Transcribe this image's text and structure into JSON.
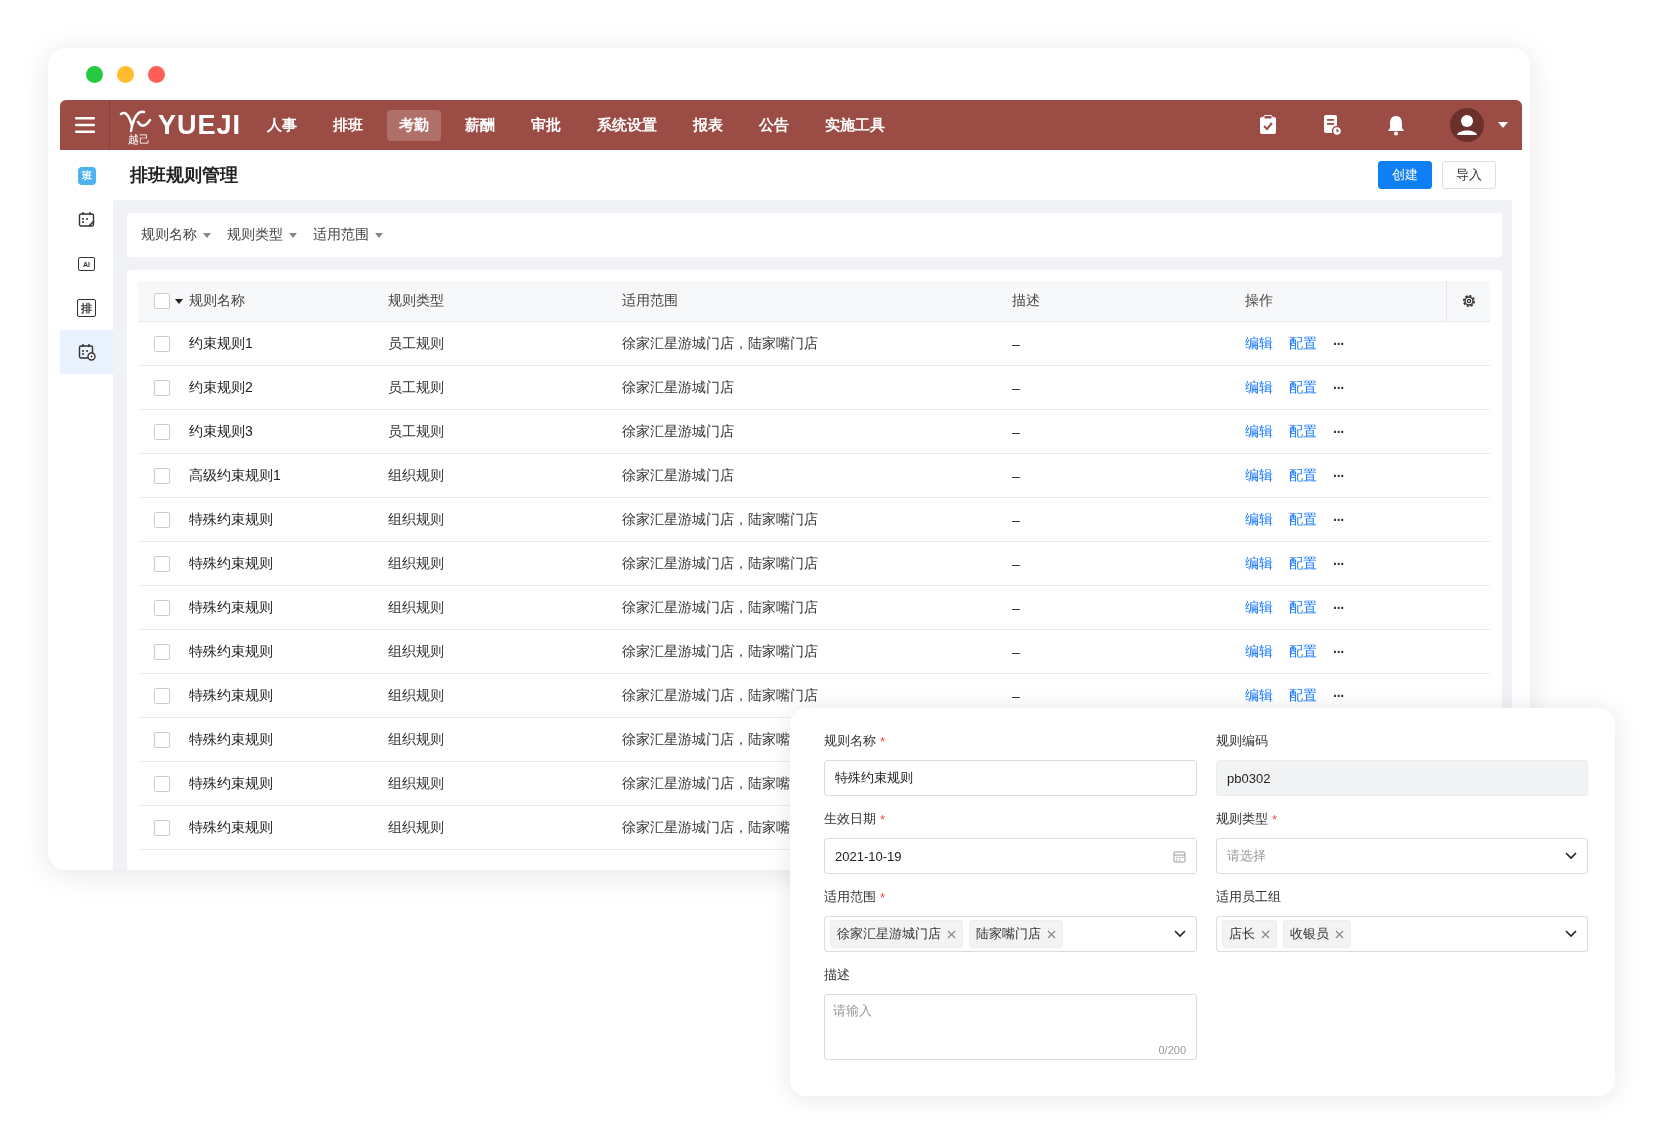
{
  "logo": {
    "mark": "越己",
    "text": "YUEJI"
  },
  "nav": [
    {
      "label": "人事",
      "selected": false
    },
    {
      "label": "排班",
      "selected": false
    },
    {
      "label": "考勤",
      "selected": true
    },
    {
      "label": "薪酬",
      "selected": false
    },
    {
      "label": "审批",
      "selected": false
    },
    {
      "label": "系统设置",
      "selected": false
    },
    {
      "label": "报表",
      "selected": false
    },
    {
      "label": "公告",
      "selected": false
    },
    {
      "label": "实施工具",
      "selected": false
    }
  ],
  "sidebar": [
    {
      "kind": "badge",
      "glyph": "班",
      "selected": false
    },
    {
      "kind": "calendar-edit",
      "selected": false
    },
    {
      "kind": "monitor",
      "glyph": "AI",
      "selected": false
    },
    {
      "kind": "board",
      "glyph": "排",
      "selected": false
    },
    {
      "kind": "calendar-gear",
      "selected": true
    }
  ],
  "page_title": "排班规则管理",
  "actions": [
    {
      "label": "创建",
      "kind": "primary"
    },
    {
      "label": "导入",
      "kind": "default"
    }
  ],
  "filters": [
    "规则名称",
    "规则类型",
    "适用范围"
  ],
  "table": {
    "select_all_checked": false,
    "columns": [
      "规则名称",
      "规则类型",
      "适用范围",
      "描述",
      "操作"
    ],
    "rows": [
      {
        "name": "约束规则1",
        "type": "员工规则",
        "scope": "徐家汇星游城门店，陆家嘴门店",
        "desc": "–",
        "ops": [
          "编辑",
          "配置",
          "···"
        ],
        "checked": false
      },
      {
        "name": "约束规则2",
        "type": "员工规则",
        "scope": "徐家汇星游城门店",
        "desc": "–",
        "ops": [
          "编辑",
          "配置",
          "···"
        ],
        "checked": false
      },
      {
        "name": "约束规则3",
        "type": "员工规则",
        "scope": "徐家汇星游城门店",
        "desc": "–",
        "ops": [
          "编辑",
          "配置",
          "···"
        ],
        "checked": false
      },
      {
        "name": "高级约束规则1",
        "type": "组织规则",
        "scope": "徐家汇星游城门店",
        "desc": "–",
        "ops": [
          "编辑",
          "配置",
          "···"
        ],
        "checked": false
      },
      {
        "name": "特殊约束规则",
        "type": "组织规则",
        "scope": "徐家汇星游城门店，陆家嘴门店",
        "desc": "–",
        "ops": [
          "编辑",
          "配置",
          "···"
        ],
        "checked": false
      },
      {
        "name": "特殊约束规则",
        "type": "组织规则",
        "scope": "徐家汇星游城门店，陆家嘴门店",
        "desc": "–",
        "ops": [
          "编辑",
          "配置",
          "···"
        ],
        "checked": false
      },
      {
        "name": "特殊约束规则",
        "type": "组织规则",
        "scope": "徐家汇星游城门店，陆家嘴门店",
        "desc": "–",
        "ops": [
          "编辑",
          "配置",
          "···"
        ],
        "checked": false
      },
      {
        "name": "特殊约束规则",
        "type": "组织规则",
        "scope": "徐家汇星游城门店，陆家嘴门店",
        "desc": "–",
        "ops": [
          "编辑",
          "配置",
          "···"
        ],
        "checked": false
      },
      {
        "name": "特殊约束规则",
        "type": "组织规则",
        "scope": "徐家汇星游城门店，陆家嘴门店",
        "desc": "–",
        "ops": [
          "编辑",
          "配置",
          "···"
        ],
        "checked": false
      },
      {
        "name": "特殊约束规则",
        "type": "组织规则",
        "scope": "徐家汇星游城门店，陆家嘴",
        "checked": false
      },
      {
        "name": "特殊约束规则",
        "type": "组织规则",
        "scope": "徐家汇星游城门店，陆家嘴",
        "checked": false
      },
      {
        "name": "特殊约束规则",
        "type": "组织规则",
        "scope": "徐家汇星游城门店，陆家嘴",
        "checked": false
      }
    ]
  },
  "form": {
    "required_mark": "*",
    "fields": [
      {
        "label": "规则名称",
        "required": true,
        "kind": "text",
        "value": "特殊约束规则"
      },
      {
        "label": "规则编码",
        "required": false,
        "kind": "readonly",
        "value": "pb0302"
      },
      {
        "label": "生效日期",
        "required": true,
        "kind": "date",
        "value": "2021-10-19"
      },
      {
        "label": "规则类型",
        "required": true,
        "kind": "select",
        "placeholder": "请选择"
      },
      {
        "label": "适用范围",
        "required": true,
        "kind": "tags",
        "tags": [
          "徐家汇星游城门店",
          "陆家嘴门店"
        ]
      },
      {
        "label": "适用员工组",
        "required": false,
        "kind": "tags",
        "tags": [
          "店长",
          "收银员"
        ]
      },
      {
        "label": "描述",
        "required": false,
        "kind": "textarea",
        "placeholder": "请输入",
        "counter": "0/200"
      }
    ]
  }
}
